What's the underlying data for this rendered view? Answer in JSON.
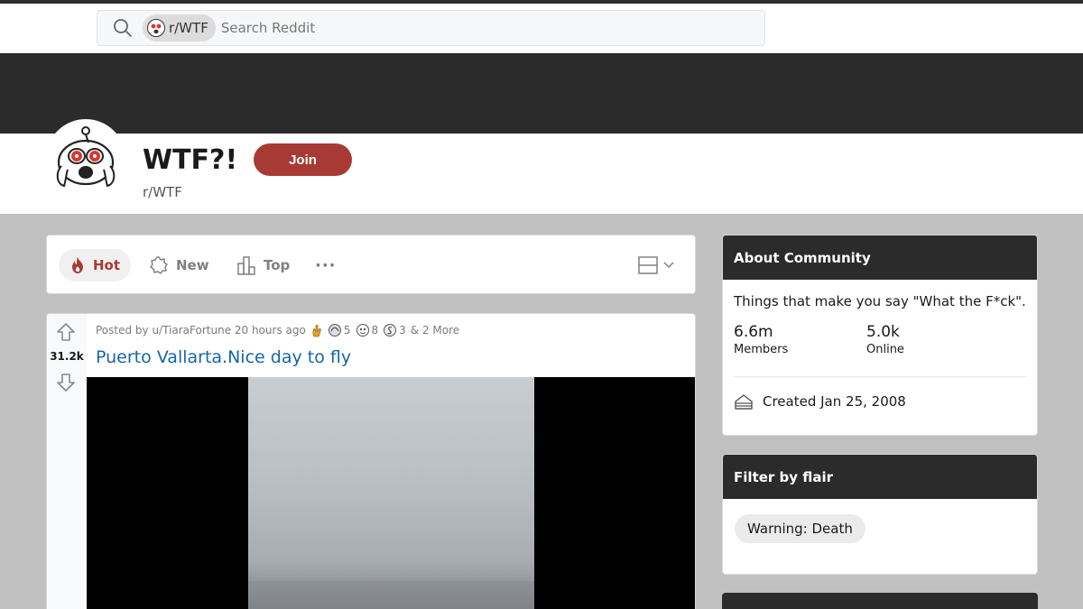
{
  "search": {
    "chip_label": "r/WTF",
    "placeholder": "Search Reddit"
  },
  "subreddit": {
    "title": "WTF?!",
    "name": "r/WTF",
    "join_label": "Join"
  },
  "sort": {
    "hot": "Hot",
    "new": "New",
    "top": "Top",
    "more": "···"
  },
  "post": {
    "score": "31.2k",
    "posted_by": "Posted by u/TiaraFortune 20 hours ago",
    "awards": [
      {
        "icon": "award-icon-1",
        "count": "5"
      },
      {
        "icon": "award-icon-2",
        "count": "8"
      },
      {
        "icon": "award-icon-3",
        "count": "3"
      }
    ],
    "more_awards": "& 2 More",
    "title": "Puerto Vallarta.Nice day to fly"
  },
  "about": {
    "heading": "About Community",
    "description": "Things that make you say \"What the F*ck\".",
    "members_count": "6.6m",
    "members_label": "Members",
    "online_count": "5.0k",
    "online_label": "Online",
    "created": "Created Jan 25, 2008"
  },
  "flair": {
    "heading": "Filter by flair",
    "items": [
      "Warning: Death"
    ]
  },
  "colors": {
    "accent": "#a83a35",
    "header_dark": "#2b2b2b",
    "link": "#1666a6"
  }
}
